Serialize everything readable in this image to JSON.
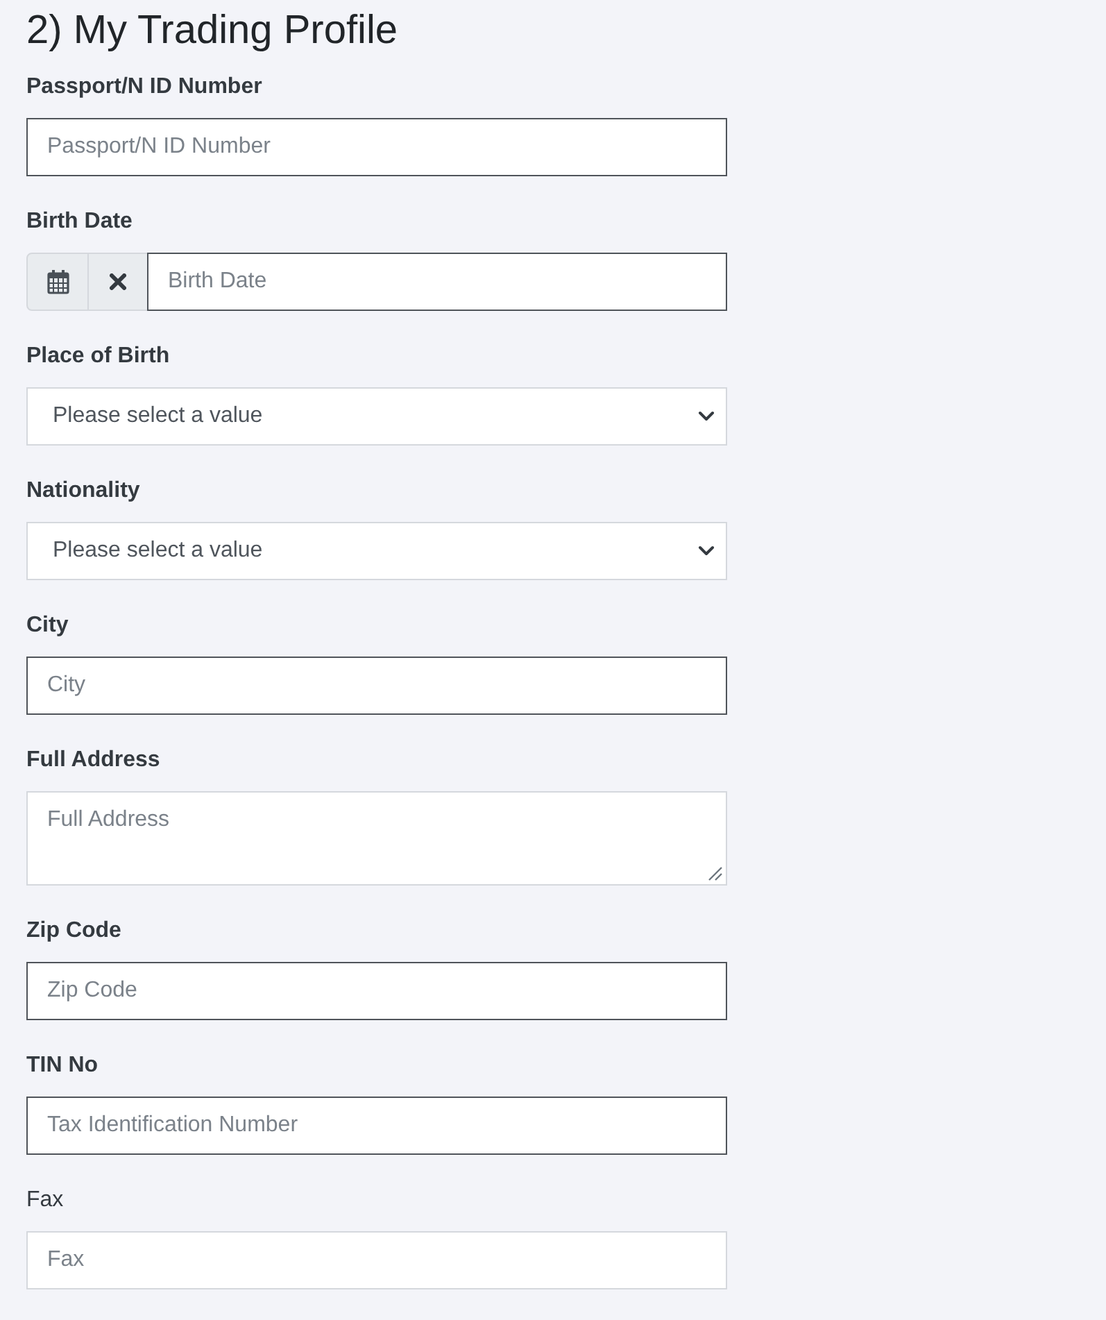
{
  "title": "2) My Trading Profile",
  "fields": [
    {
      "kind": "text",
      "label": "Passport/N ID Number",
      "placeholder": "Passport/N ID Number",
      "required": true,
      "outlined": true
    },
    {
      "kind": "date",
      "label": "Birth Date",
      "placeholder": "Birth Date",
      "required": true,
      "outlined": true
    },
    {
      "kind": "select",
      "label": "Place of Birth",
      "value": "Please select a value",
      "required": true,
      "outlined": false
    },
    {
      "kind": "select",
      "label": "Nationality",
      "value": "Please select a value",
      "required": true,
      "outlined": false
    },
    {
      "kind": "text",
      "label": "City",
      "placeholder": "City",
      "required": true,
      "outlined": true
    },
    {
      "kind": "textarea",
      "label": "Full Address",
      "placeholder": "Full Address",
      "required": true,
      "outlined": false
    },
    {
      "kind": "text",
      "label": "Zip Code",
      "placeholder": "Zip Code",
      "required": true,
      "outlined": true
    },
    {
      "kind": "text",
      "label": "TIN No",
      "placeholder": "Tax Identification Number",
      "required": true,
      "outlined": true
    },
    {
      "kind": "text",
      "label": "Fax",
      "placeholder": "Fax",
      "required": false,
      "outlined": false
    }
  ]
}
